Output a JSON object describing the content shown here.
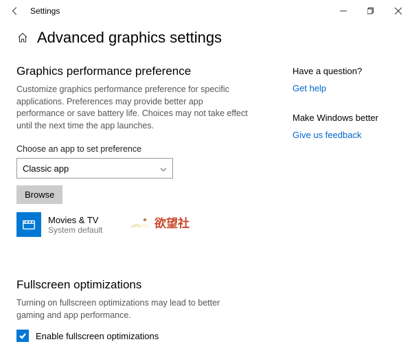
{
  "window": {
    "title": "Settings"
  },
  "page": {
    "title": "Advanced graphics settings"
  },
  "graphics": {
    "heading": "Graphics performance preference",
    "description": "Customize graphics performance preference for specific applications. Preferences may provide better app performance or save battery life. Choices may not take effect until the next time the app launches.",
    "choose_label": "Choose an app to set preference",
    "dropdown_value": "Classic app",
    "browse_label": "Browse",
    "app": {
      "name": "Movies & TV",
      "status": "System default"
    }
  },
  "fullscreen": {
    "heading": "Fullscreen optimizations",
    "description": "Turning on fullscreen optimizations may lead to better gaming and app performance.",
    "checkbox_label": "Enable fullscreen optimizations",
    "checked": true
  },
  "sidebar": {
    "question_heading": "Have a question?",
    "help_link": "Get help",
    "feedback_heading": "Make Windows better",
    "feedback_link": "Give us feedback"
  },
  "watermark": {
    "text": "欲望社"
  }
}
